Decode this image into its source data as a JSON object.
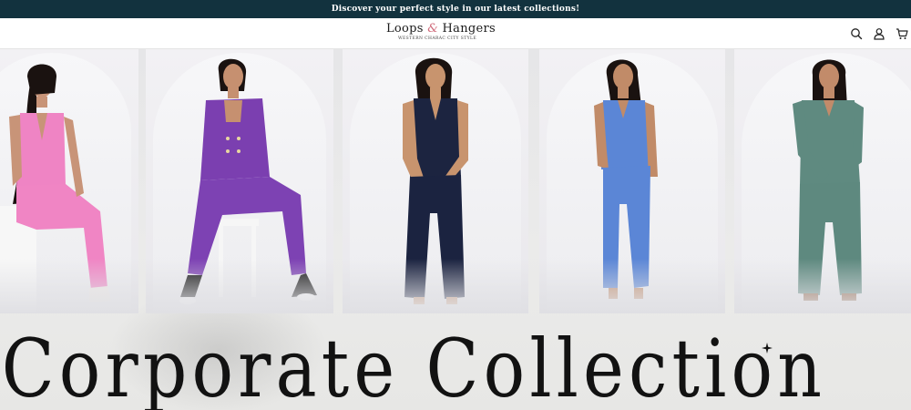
{
  "announcement": {
    "text": "Discover your perfect style in our latest collections!"
  },
  "header": {
    "brand": {
      "part1": "Loops",
      "ampersand": "&",
      "part2": "Hangers",
      "tagline": "WESTERN CHARAC CITY STYLE"
    },
    "icons": [
      "search-icon",
      "account-icon",
      "cart-icon"
    ]
  },
  "hero": {
    "title": "Corporate Collection",
    "outfits": [
      {
        "name": "pink-vest-set",
        "color": "#ee7fc0"
      },
      {
        "name": "purple-blazer-set",
        "color": "#7b3fb0"
      },
      {
        "name": "navy-vest-set",
        "color": "#1c2440"
      },
      {
        "name": "blue-vest-set",
        "color": "#5b86d6"
      },
      {
        "name": "sage-shirt-set",
        "color": "#5f8a80"
      }
    ]
  },
  "colors": {
    "announcement_bg": "#12323e",
    "header_bg": "#ffffff",
    "text": "#121212"
  }
}
